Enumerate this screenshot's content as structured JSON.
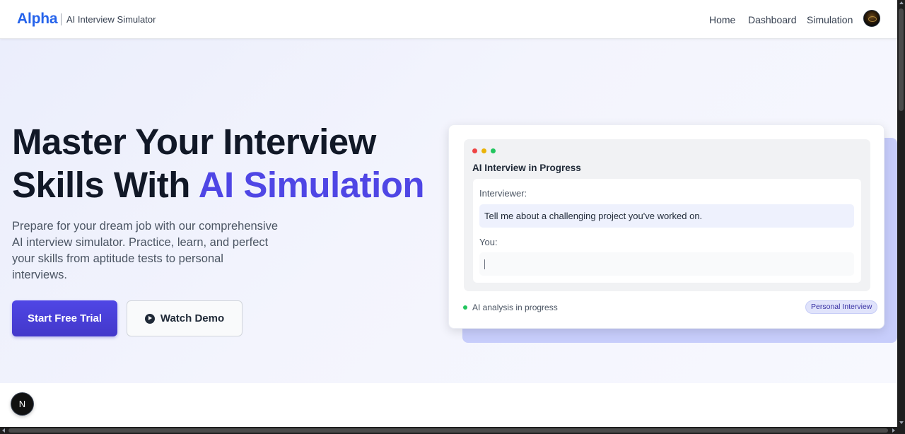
{
  "header": {
    "brand": "Alpha",
    "subtitle": "AI Interview Simulator",
    "nav": [
      "Home",
      "Dashboard",
      "Simulation"
    ],
    "avatar_icon": "user-avatar"
  },
  "hero": {
    "title_line1": "Master Your Interview",
    "title_line2_prefix": "Skills With ",
    "title_line2_accent": "AI Simulation",
    "description": "Prepare for your dream job with our comprehensive AI interview simulator. Practice, learn, and perfect your skills from aptitude tests to personal interviews.",
    "primary_button": "Start Free Trial",
    "secondary_button": "Watch Demo",
    "accent_color": "#4f46e5"
  },
  "card": {
    "title": "AI Interview in Progress",
    "interviewer_label": "Interviewer:",
    "question": "Tell me about a challenging project you've worked on.",
    "you_label": "You:",
    "answer_value": "",
    "status": "AI analysis in progress",
    "badge": "Personal Interview"
  },
  "floating_button": "N"
}
